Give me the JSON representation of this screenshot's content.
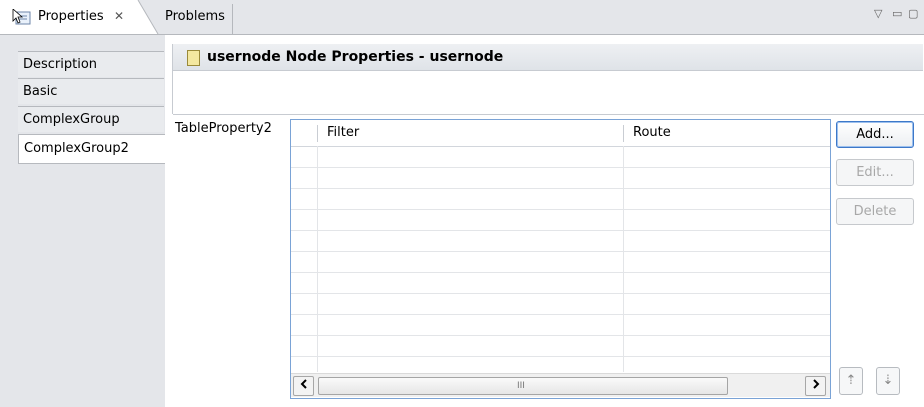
{
  "tabs": {
    "properties_label": "Properties",
    "properties_close": "✕",
    "problems_label": "Problems"
  },
  "view_controls": {
    "menu": "▽",
    "minimize": "▭",
    "maximize": "▢"
  },
  "sidebar": {
    "items": [
      {
        "label": "Description"
      },
      {
        "label": "Basic"
      },
      {
        "label": "ComplexGroup"
      },
      {
        "label": "ComplexGroup2",
        "selected": true
      }
    ]
  },
  "header": {
    "title": "usernode Node Properties - usernode"
  },
  "property": {
    "label": "TableProperty2",
    "columns": [
      "Filter",
      "Route"
    ],
    "rows": [],
    "scroll_grip": "III"
  },
  "buttons": {
    "add": "Add...",
    "edit": "Edit...",
    "delete": "Delete",
    "move_up": "⇡",
    "move_down": "⇣"
  },
  "colors": {
    "accent": "#3d78c8",
    "table_border": "#7aa3d6",
    "tab_bg": "#e4e6ea"
  }
}
